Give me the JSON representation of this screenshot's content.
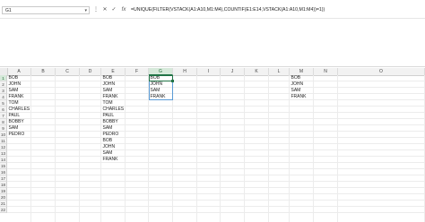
{
  "formula_bar": {
    "name_box": "G1",
    "cancel_glyph": "✕",
    "enter_glyph": "✓",
    "fx_label": "fx",
    "formula": "=UNIQUE(FILTER(VSTACK(A1:A10,M1:M4),COUNTIF(E1:E14,VSTACK(A1:A10,M1:M4))=1))",
    "dropdown_glyph": "▾",
    "more_glyph": "⋮"
  },
  "grid": {
    "columns": [
      "A",
      "B",
      "C",
      "D",
      "E",
      "F",
      "G",
      "H",
      "I",
      "J",
      "K",
      "L",
      "M",
      "N",
      "O"
    ],
    "rows": [
      "1",
      "2",
      "3",
      "4",
      "5",
      "6",
      "7",
      "8",
      "9",
      "10",
      "11",
      "12",
      "13",
      "14",
      "15",
      "16",
      "17",
      "18",
      "19",
      "20",
      "21",
      "22"
    ],
    "selected_column": "G",
    "selected_row": "1",
    "colA": [
      "BOB",
      "JOHN",
      "SAM",
      "FRANK",
      "TOM",
      "CHARLES",
      "PAUL",
      "BOBBY",
      "SAM",
      "PEDRO"
    ],
    "colE": [
      "BOB",
      "JOHN",
      "SAM",
      "FRANK",
      "TOM",
      "CHARLES",
      "PAUL",
      "BOBBY",
      "SAM",
      "PEDRO",
      "BOB",
      "JOHN",
      "SAM",
      "FRANK"
    ],
    "colG": [
      "BOB",
      "JOHN",
      "SAM",
      "FRANK"
    ],
    "colM": [
      "BOB",
      "JOHN",
      "SAM",
      "FRANK"
    ]
  }
}
